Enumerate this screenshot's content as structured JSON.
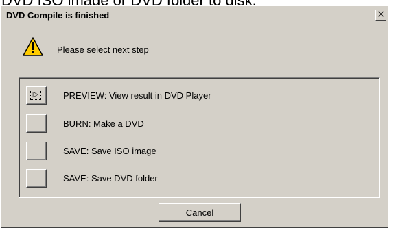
{
  "background": {
    "text": "DVD ISO image or DVD folder to disk."
  },
  "dialog": {
    "title": "DVD Compile is finished",
    "close_glyph": "×",
    "prompt": "Please select next step",
    "warning_icon": "warning-triangle-icon",
    "options": [
      {
        "label": "PREVIEW: View result in DVD Player",
        "focused": true,
        "glyph": "▷"
      },
      {
        "label": "BURN: Make a DVD",
        "focused": false
      },
      {
        "label": "SAVE: Save ISO image",
        "focused": false
      },
      {
        "label": "SAVE: Save DVD folder",
        "focused": false
      }
    ],
    "cancel_label": "Cancel"
  },
  "colors": {
    "face": "#d4d0c8",
    "warning_fill": "#ffcc00"
  }
}
